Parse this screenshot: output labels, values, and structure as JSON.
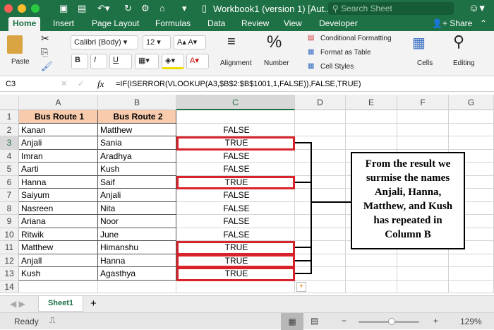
{
  "titlebar": {
    "title": "Workbook1 (version 1) [Aut...",
    "search_placeholder": "Search Sheet"
  },
  "tabs": [
    "Home",
    "Insert",
    "Page Layout",
    "Formulas",
    "Data",
    "Review",
    "View",
    "Developer"
  ],
  "share": "Share",
  "ribbon": {
    "paste": "Paste",
    "font": "Calibri (Body)",
    "size": "12",
    "bold": "B",
    "italic": "I",
    "underline": "U",
    "alignment": "Alignment",
    "number": "Number",
    "cond_format": "Conditional Formatting",
    "format_table": "Format as Table",
    "cell_styles": "Cell Styles",
    "cells": "Cells",
    "editing": "Editing"
  },
  "formula_bar": {
    "name_box": "C3",
    "fx": "fx",
    "formula": "=IF(ISERROR(VLOOKUP(A3,$B$2:$B$1001,1,FALSE)),FALSE,TRUE)"
  },
  "columns": [
    "A",
    "B",
    "C",
    "D",
    "E",
    "F",
    "G"
  ],
  "rows": [
    [
      "Bus Route 1",
      "Bus Route 2",
      ""
    ],
    [
      "Kanan",
      "Matthew",
      "FALSE"
    ],
    [
      "Anjali",
      "Sania",
      "TRUE"
    ],
    [
      "Imran",
      "Aradhya",
      "FALSE"
    ],
    [
      "Aarti",
      "Kush",
      "FALSE"
    ],
    [
      "Hanna",
      "Saif",
      "TRUE"
    ],
    [
      "Saiyum",
      "Anjali",
      "FALSE"
    ],
    [
      "Nasreen",
      "Nita",
      "FALSE"
    ],
    [
      "Ariana",
      "Noor",
      "FALSE"
    ],
    [
      "Ritwik",
      "June",
      "FALSE"
    ],
    [
      "Matthew",
      "Himanshu",
      "TRUE"
    ],
    [
      "Anjall",
      "Hanna",
      "TRUE"
    ],
    [
      "Kush",
      "Agasthya",
      "TRUE"
    ],
    [
      "",
      "",
      ""
    ]
  ],
  "callout": "From the result we surmise the names Anjali, Hanna, Matthew, and Kush has repeated in Column B",
  "sheet_tab": "Sheet1",
  "add_sheet": "+",
  "status": {
    "ready": "Ready",
    "zoom": "129%",
    "zoom_level_percent": 129
  },
  "colors": {
    "accent": "#1e7145",
    "header_fill": "#f8cbad",
    "highlight": "#d9232a"
  }
}
